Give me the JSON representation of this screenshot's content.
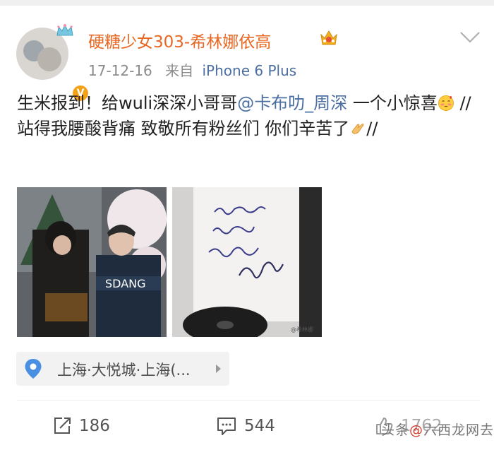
{
  "post": {
    "username": "硬糖少女303-希林娜依高",
    "date": "17-12-16",
    "source_prefix": "来自",
    "device": "iPhone 6 Plus",
    "text_part1": "生米报到！给wuli深深小哥哥",
    "mention": "@卡布叻_周深",
    "text_part2": " 一个小惊喜",
    "text_part3": " //站得我腰酸背痛 致敬所有粉丝们 你们辛苦了",
    "text_part4": "//",
    "location": "上海·大悦城·上海(...",
    "photo2_watermark": "@希林娜"
  },
  "actions": {
    "reposts": "186",
    "comments": "544",
    "likes": "1762"
  },
  "watermark": {
    "prefix": "头条",
    "highlight": "@",
    "site": "六西龙网",
    "suffix": "去"
  },
  "colors": {
    "username": "#e86722",
    "link": "#4b6fa2",
    "meta": "#8a8a8a"
  },
  "icons": [
    "crown-icon",
    "vip-badge-icon",
    "chevron-down-icon",
    "location-pin-icon",
    "repost-icon",
    "comment-icon",
    "like-icon"
  ]
}
